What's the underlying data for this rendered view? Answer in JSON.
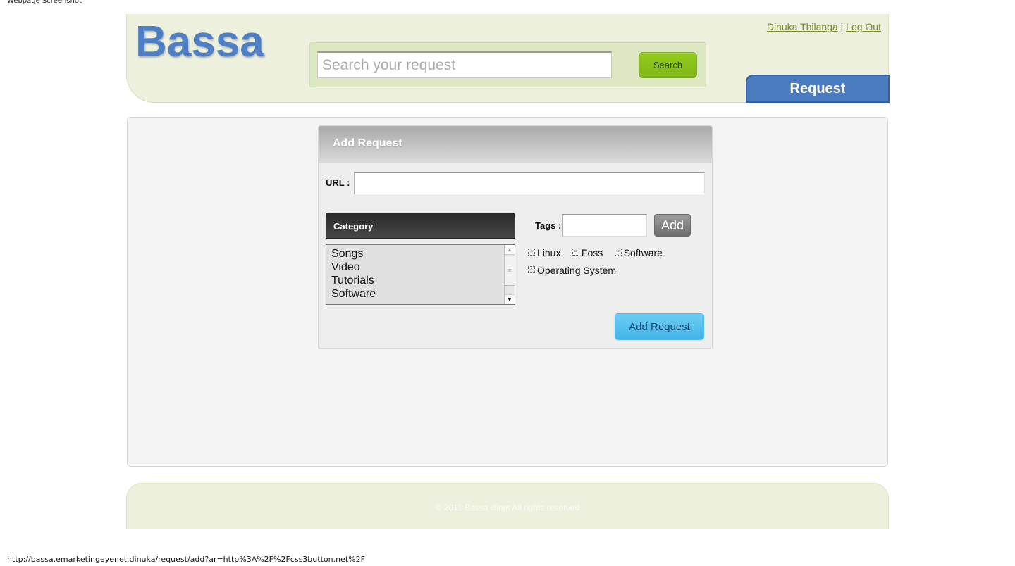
{
  "screenshot_label": "Webpage Screenshot",
  "header": {
    "logo": "Bassa",
    "search": {
      "placeholder": "Search your request",
      "value": "",
      "button_label": "Search"
    },
    "user": {
      "name": "Dinuka Thilanga",
      "separator": "|",
      "logout_label": "Log Out"
    },
    "nav_tab": "Request"
  },
  "panel": {
    "title": "Add Request",
    "url_label": "URL :",
    "url_value": "",
    "category": {
      "heading": "Category",
      "options": [
        "Songs",
        "Video",
        "Tutorials",
        "Software"
      ]
    },
    "tags": {
      "label": "Tags :",
      "input_value": "",
      "add_label": "Add",
      "items": [
        "Linux",
        "Foss",
        "Software",
        "Operating System"
      ]
    },
    "submit_label": "Add Request"
  },
  "footer": {
    "text": "© 2011 Bassa client All rights reserved"
  },
  "status_bar": {
    "url": "http://bassa.emarketingeyenet.dinuka/request/add?ar=http%3A%2F%2Fcss3button.net%2F"
  },
  "colors": {
    "brand_blue": "#4e7fc4",
    "header_green": "#ecf0dc",
    "search_button": "#8cc41c",
    "add_request_button": "#4fbdec"
  }
}
